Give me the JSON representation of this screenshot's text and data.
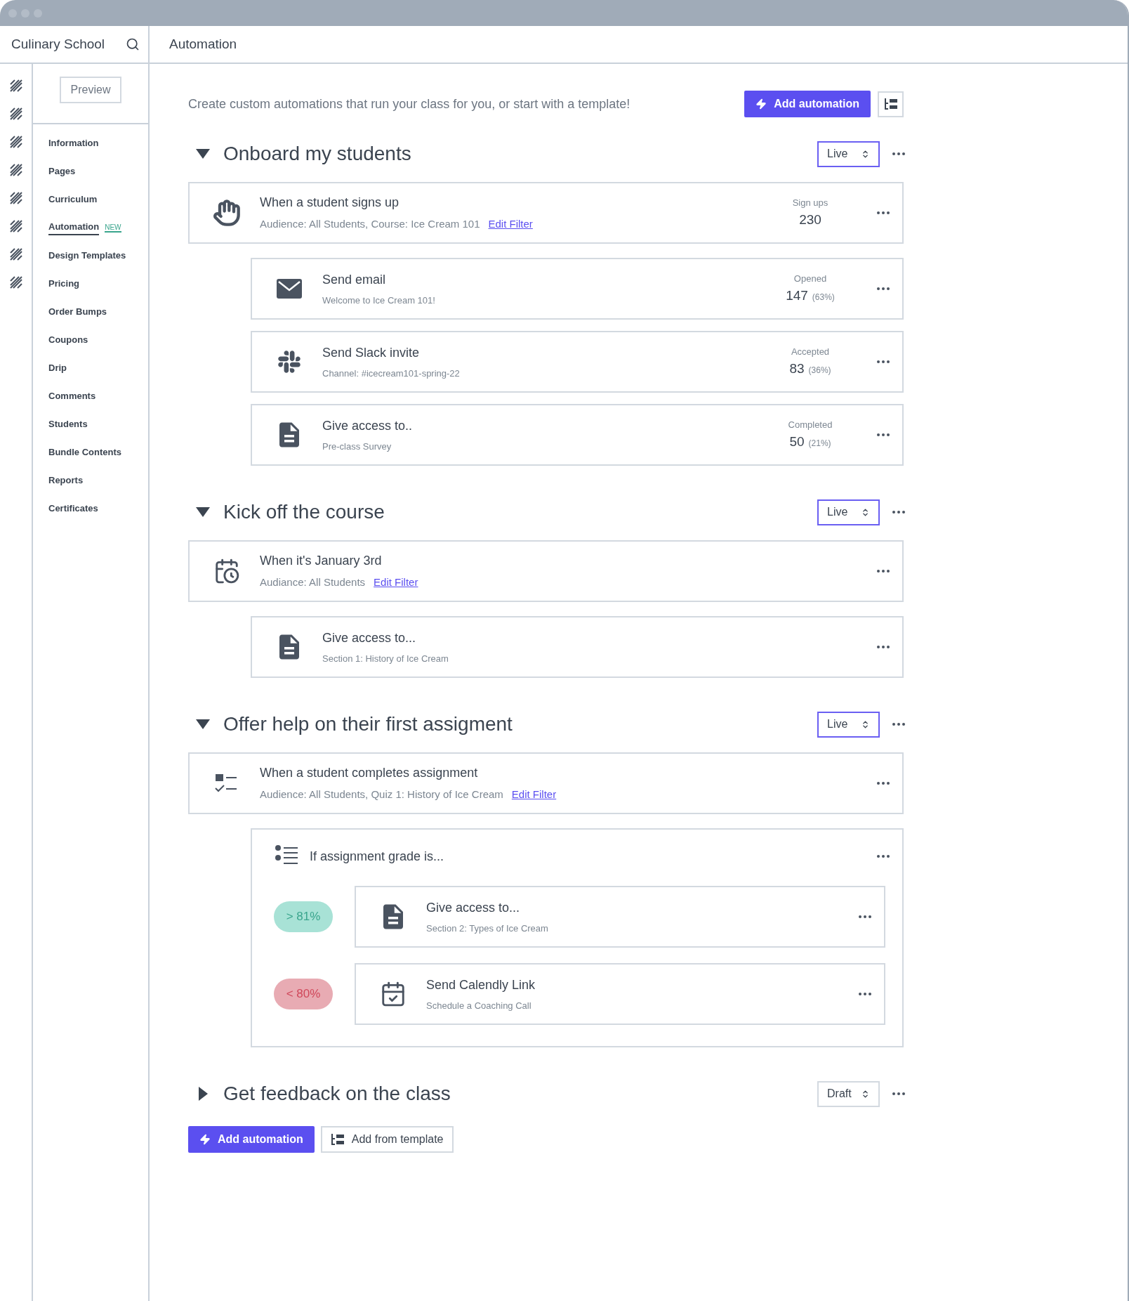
{
  "header": {
    "school_title": "Culinary School",
    "page_title": "Automation"
  },
  "sidebar": {
    "preview_button": "Preview",
    "items": [
      {
        "label": "Information",
        "selected": false
      },
      {
        "label": "Pages",
        "selected": false
      },
      {
        "label": "Curriculum",
        "selected": false
      },
      {
        "label": "Automation",
        "selected": true,
        "badge": "NEW"
      },
      {
        "label": "Design Templates",
        "selected": false
      },
      {
        "label": "Pricing",
        "selected": false
      },
      {
        "label": "Order Bumps",
        "selected": false
      },
      {
        "label": "Coupons",
        "selected": false
      },
      {
        "label": "Drip",
        "selected": false
      },
      {
        "label": "Comments",
        "selected": false
      },
      {
        "label": "Students",
        "selected": false
      },
      {
        "label": "Bundle Contents",
        "selected": false
      },
      {
        "label": "Reports",
        "selected": false
      },
      {
        "label": "Certificates",
        "selected": false
      }
    ]
  },
  "intro": "Create custom automations that run your class for you, or start with a template!",
  "add_automation_button": "Add automation",
  "sections": [
    {
      "title": "Onboard my students",
      "expanded": true,
      "status": {
        "value": "Live",
        "active": true
      },
      "trigger": {
        "kind": "hand",
        "title": "When a student signs up",
        "subtitle": "Audience: All Students, Course: Ice Cream 101",
        "link": "Edit Filter",
        "stat": {
          "label": "Sign ups",
          "value": "230"
        }
      },
      "steps": [
        {
          "kind": "mail",
          "title": "Send email",
          "subtitle": "Welcome to Ice Cream 101!",
          "stat": {
            "label": "Opened",
            "value": "147",
            "percent": "(63%)"
          }
        },
        {
          "kind": "slack",
          "title": "Send Slack invite",
          "subtitle": "Channel: #icecream101-spring-22",
          "stat": {
            "label": "Accepted",
            "value": "83",
            "percent": "(36%)"
          }
        },
        {
          "kind": "document",
          "title": "Give access to..",
          "subtitle": "Pre-class Survey",
          "stat": {
            "label": "Completed",
            "value": "50",
            "percent": "(21%)"
          }
        }
      ]
    },
    {
      "title": "Kick off the course",
      "expanded": true,
      "status": {
        "value": "Live",
        "active": true
      },
      "trigger": {
        "kind": "calendar",
        "title": "When it's January 3rd",
        "subtitle": "Audiance: All Students",
        "link": "Edit Filter"
      },
      "steps": [
        {
          "kind": "document",
          "title": "Give access to...",
          "subtitle": "Section 1: History of Ice Cream"
        }
      ]
    },
    {
      "title": "Offer help on their first assigment",
      "expanded": true,
      "status": {
        "value": "Live",
        "active": true
      },
      "trigger": {
        "kind": "checklist",
        "title": "When a student completes assignment",
        "subtitle": "Audience: All Students, Quiz 1: History of Ice Cream",
        "link": "Edit Filter"
      },
      "steps": [
        {
          "kind": "list",
          "title": "If assignment grade is...",
          "branches": [
            {
              "grade": "> 81%",
              "kind": "pass",
              "step": {
                "kind": "document",
                "title": "Give access to...",
                "subtitle": "Section 2: Types of Ice Cream"
              }
            },
            {
              "grade": "< 80%",
              "kind": "fail",
              "step": {
                "kind": "scheduled",
                "title": "Send Calendly Link",
                "subtitle": "Schedule a Coaching Call"
              }
            }
          ]
        }
      ]
    },
    {
      "title": "Get feedback on the class",
      "expanded": false,
      "status": {
        "value": "Draft",
        "active": false
      }
    }
  ],
  "footer": {
    "add_button": "Add automation",
    "template_button": "Add from template"
  }
}
